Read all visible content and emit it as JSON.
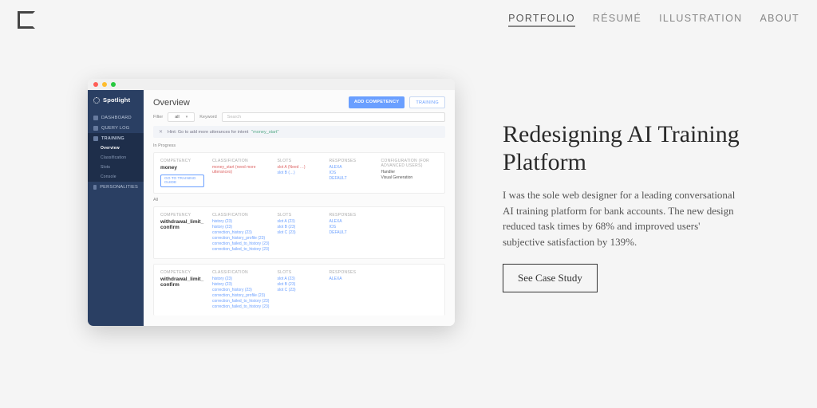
{
  "nav": {
    "items": [
      {
        "label": "PORTFOLIO",
        "active": true
      },
      {
        "label": "RÉSUMÉ",
        "active": false
      },
      {
        "label": "ILLUSTRATION",
        "active": false
      },
      {
        "label": "ABOUT",
        "active": false
      }
    ]
  },
  "hero": {
    "title": "Redesigning AI Training Platform",
    "body": "I was the sole web designer for a leading conversational AI training platform for bank accounts. The new design reduced task times by 68% and improved users' subjective satisfaction by 139%.",
    "cta": "See Case Study"
  },
  "shot": {
    "brand": "Spotlight",
    "sidebar": {
      "groups": [
        {
          "label": "DASHBOARD"
        },
        {
          "label": "QUERY LOG"
        },
        {
          "label": "TRAINING",
          "sub": [
            "Overview",
            "Classification",
            "Slots",
            "Console"
          ]
        },
        {
          "label": "PERSONALITIES"
        }
      ]
    },
    "main": {
      "title": "Overview",
      "add_btn": "ADD COMPETENCY",
      "train_btn": "TRAINING",
      "filter_label": "Filter",
      "filter_value": "all",
      "keyword_label": "Keyword",
      "keyword_placeholder": "Search",
      "hint_prefix": "Hint: Go to add more utterances for intent",
      "hint_kw": "\"money_start\"",
      "sections": {
        "in_progress": "In Progress",
        "all": "All"
      },
      "cards": [
        {
          "competency_h": "COMPETENCY",
          "competency": "money",
          "cta": "GO TO TRAINING GUIDE",
          "class_h": "CLASSIFICATION",
          "class_items": [
            "money_start (need more utterances)"
          ],
          "slots_h": "SLOTS",
          "slots": [
            "slot A (Need …)",
            "slot B (…)"
          ],
          "resp_h": "RESPONSES",
          "resp": [
            "ALEXA",
            "IOS",
            "DEFAULT"
          ],
          "config_h": "CONFIGURATION (for advanced users)",
          "config": [
            "Handler",
            "Visual Generation"
          ]
        },
        {
          "competency_h": "COMPETENCY",
          "competency": "withdrawal_limit_confirm",
          "class_h": "CLASSIFICATION",
          "class_items": [
            "history (23)",
            "history (23)",
            "correction_history (23)",
            "correction_history_profile (23)",
            "correction_failed_to_history (23)",
            "correction_failed_to_history (23)"
          ],
          "slots_h": "SLOTS",
          "slots": [
            "slot A (23)",
            "slot B (23)",
            "slot C (23)"
          ],
          "resp_h": "RESPONSES",
          "resp": [
            "ALEXA",
            "IOS",
            "DEFAULT"
          ]
        },
        {
          "competency_h": "COMPETENCY",
          "competency": "withdrawal_limit_confirm",
          "class_h": "CLASSIFICATION",
          "class_items": [
            "history (23)",
            "history (23)",
            "correction_history (23)",
            "correction_history_profile (23)",
            "correction_failed_to_history (23)",
            "correction_failed_to_history (23)"
          ],
          "slots_h": "SLOTS",
          "slots": [
            "slot A (23)",
            "slot B (23)",
            "slot C (23)"
          ],
          "resp_h": "RESPONSES",
          "resp": [
            "ALEXA"
          ]
        }
      ]
    }
  }
}
